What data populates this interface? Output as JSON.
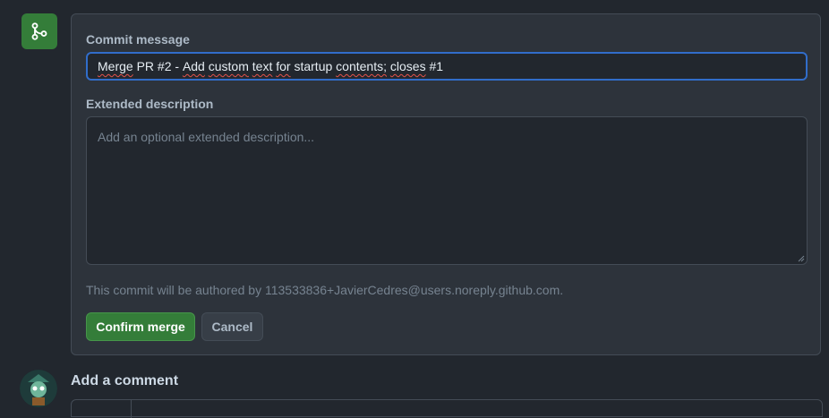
{
  "merge": {
    "icon": "git-merge-icon",
    "accent": "#347d39",
    "commit_message_label": "Commit message",
    "commit_message_value": {
      "merge_word": "Merge",
      "part1": " PR #2 - ",
      "add_word": "Add",
      "space1": " ",
      "custom_word": "custom",
      "space2": " ",
      "text_word": "text",
      "space3": " ",
      "for_word": "for",
      "part2": " startup ",
      "contents_word": "contents;",
      "space4": " ",
      "closes_word": "closes",
      "part3": " #1"
    },
    "extended_description_label": "Extended description",
    "extended_description_placeholder": "Add an optional extended description...",
    "author_note": "This commit will be authored by 113533836+JavierCedres@users.noreply.github.com.",
    "confirm_label": "Confirm merge",
    "cancel_label": "Cancel"
  },
  "comment": {
    "heading": "Add a comment"
  }
}
